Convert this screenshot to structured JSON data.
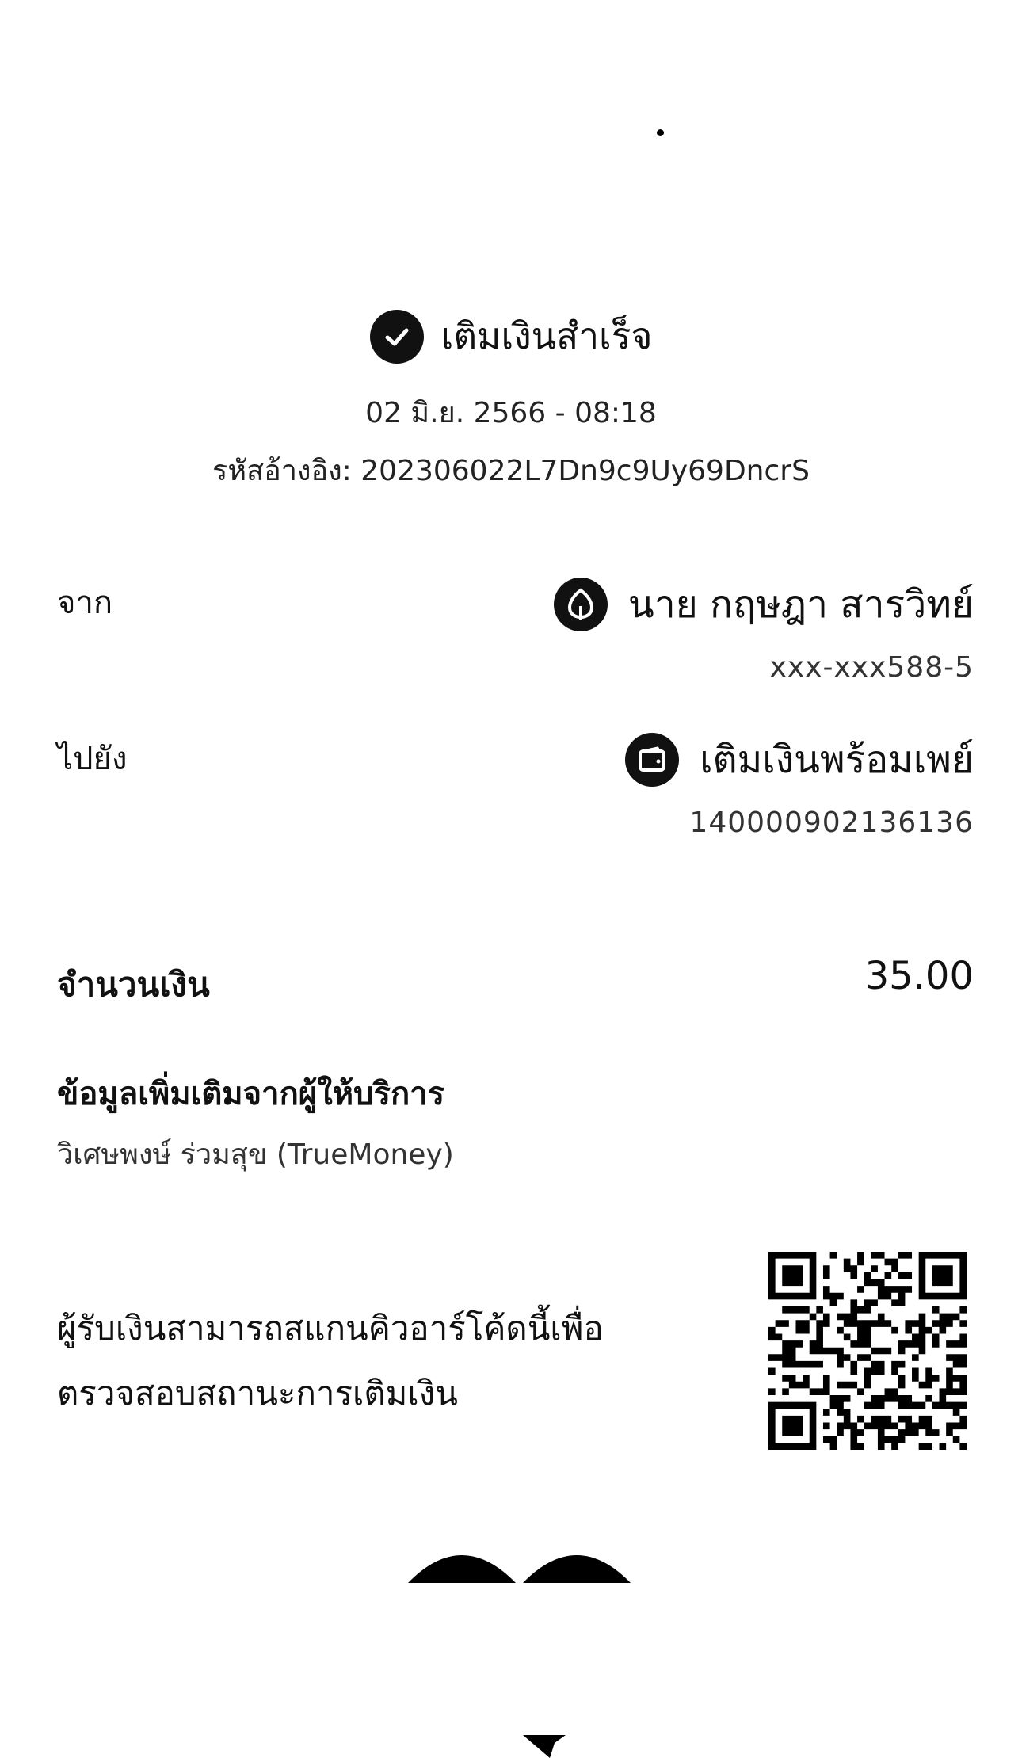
{
  "status": {
    "title": "เติมเงินสำเร็จ",
    "datetime": "02 มิ.ย. 2566 - 08:18",
    "reference": "รหัสอ้างอิง: 202306022L7Dn9c9Uy69DncrS"
  },
  "from": {
    "label": "จาก",
    "name": "นาย กฤษฎา สารวิทย์",
    "account": "xxx-xxx588-5",
    "icon": "kbank-leaf-icon"
  },
  "to": {
    "label": "ไปยัง",
    "name": "เติมเงินพร้อมเพย์",
    "account": "140000902136136",
    "icon": "wallet-icon"
  },
  "amount": {
    "label": "จำนวนเงิน",
    "value": "35.00"
  },
  "provider_info": {
    "title": "ข้อมูลเพิ่มเติมจากผู้ให้บริการ",
    "text": "วิเศษพงษ์ ร่วมสุข (TrueMoney)"
  },
  "qr": {
    "note_line1": "ผู้รับเงินสามารถสแกนคิวอาร์โค้ดนี้เพื่อ",
    "note_line2": "ตรวจสอบสถานะการเติมเงิน"
  },
  "colors": {
    "background": "#ffffff",
    "text": "#111111",
    "icon_bg": "#111111"
  }
}
